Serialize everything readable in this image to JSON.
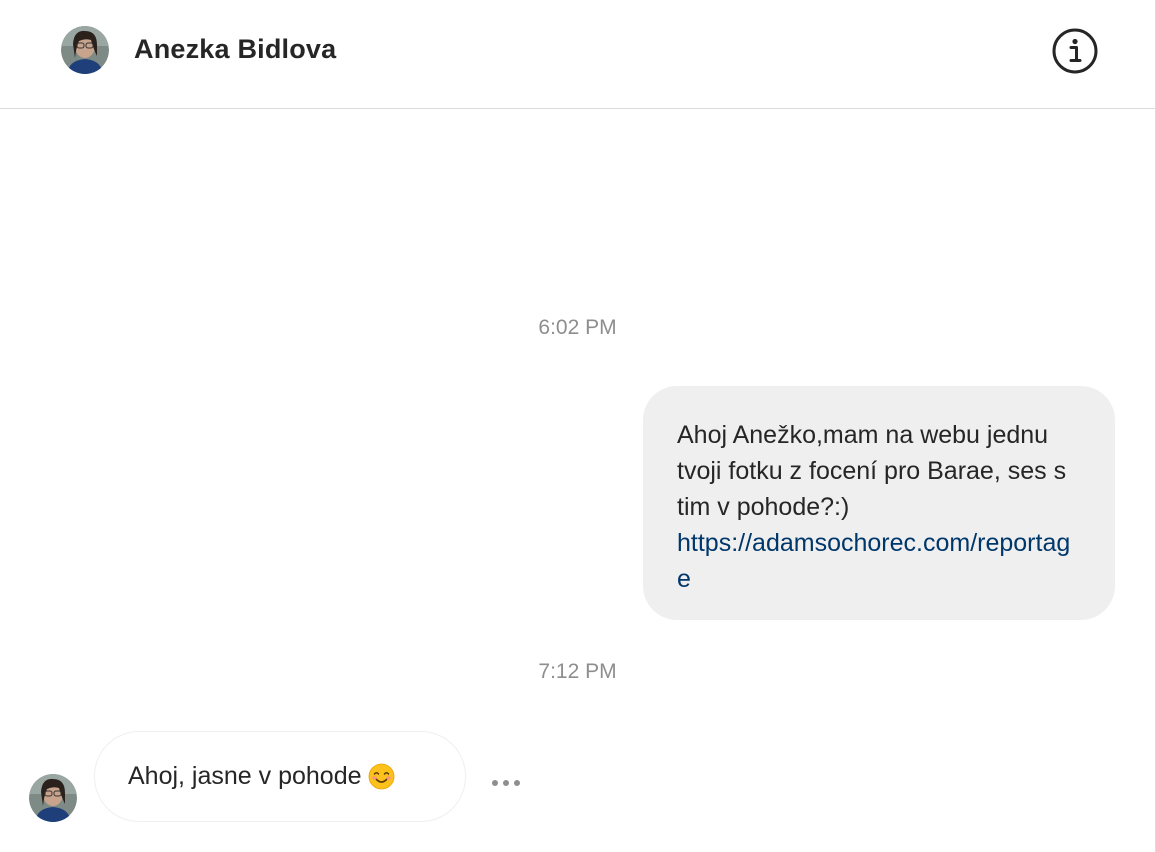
{
  "header": {
    "contact_name": "Anezka Bidlova",
    "avatar_icon": "profile-photo",
    "info_icon": "info-circle-icon"
  },
  "thread": {
    "messages": [
      {
        "timestamp": "6:02 PM",
        "direction": "outgoing",
        "text": "Ahoj Anežko,mam na webu jednu tvoji fotku z focení pro Barae, ses s tim v pohode?:)",
        "link": "https://adamsochorec.com/reportage"
      },
      {
        "timestamp": "7:12 PM",
        "direction": "incoming",
        "text": "Ahoj, jasne v pohode",
        "emoji": "smiling-face-icon"
      }
    ],
    "more_options_icon": "more-horizontal-icon"
  },
  "colors": {
    "outgoing_bubble": "#efefef",
    "link": "#00376b",
    "timestamp": "#8e8e8e",
    "text": "#262626",
    "divider": "#dbdbdb"
  }
}
